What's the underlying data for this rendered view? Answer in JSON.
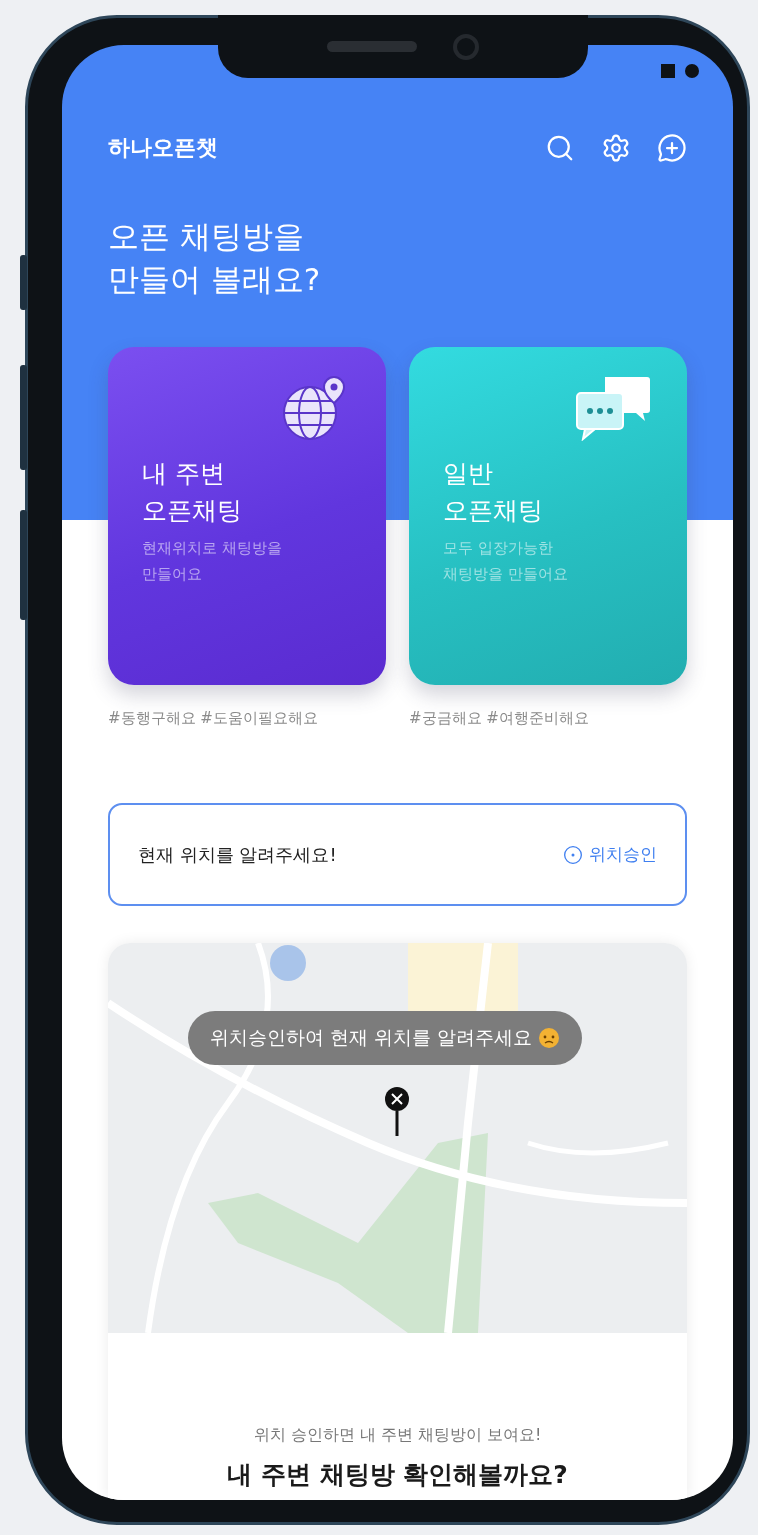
{
  "app": {
    "title": "하나오픈챗"
  },
  "header": {
    "headline_lines": [
      "오픈 채팅방을",
      "만들어 볼래요?"
    ]
  },
  "cards": [
    {
      "kind": "nearby",
      "title_lines": [
        "내 주변",
        "오픈채팅"
      ],
      "subtitle_lines": [
        "현재위치로 채팅방을",
        "만들어요"
      ],
      "tags": "#동행구해요 #도움이필요해요"
    },
    {
      "kind": "general",
      "title_lines": [
        "일반",
        "오픈채팅"
      ],
      "subtitle_lines": [
        "모두 입장가능한",
        "채팅방을 만들어요"
      ],
      "tags": "#궁금해요 #여행준비해요"
    }
  ],
  "location_prompt": {
    "text": "현재 위치를 알려주세요!",
    "button": "위치승인"
  },
  "map": {
    "tooltip": "위치승인하여 현재 위치를 알려주세요"
  },
  "footer": {
    "caption": "위치 승인하면 내 주변 채팅방이 보여요!",
    "title": "내 주변 채팅방 확인해볼까요?"
  }
}
